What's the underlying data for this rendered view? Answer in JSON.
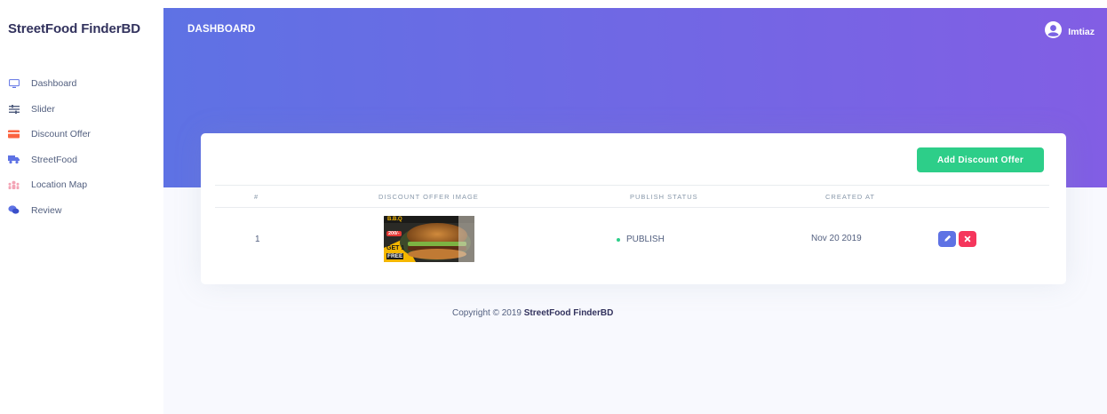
{
  "sidebar": {
    "brand": "StreetFood FinderBD",
    "items": [
      {
        "label": "Dashboard",
        "icon": "monitor-icon",
        "color": "#5e72e4"
      },
      {
        "label": "Slider",
        "icon": "sliders-icon",
        "color": "#525f7f"
      },
      {
        "label": "Discount Offer",
        "icon": "credit-card-icon",
        "color": "#fb6340"
      },
      {
        "label": "StreetFood",
        "icon": "delivery-truck-icon",
        "color": "#5e72e4"
      },
      {
        "label": "Location Map",
        "icon": "map-people-icon",
        "color": "#f3a4b5"
      },
      {
        "label": "Review",
        "icon": "review-bubble-icon",
        "color": "#5e72e4"
      }
    ]
  },
  "header": {
    "title": "DASHBOARD",
    "user_name": "Imtiaz",
    "gradient_start": "#5e72e4",
    "gradient_end": "#825ee4"
  },
  "card": {
    "add_button": "Add Discount Offer",
    "columns": [
      "#",
      "DISCOUNT OFFER IMAGE",
      "PUBLISH STATUS",
      "CREATED AT"
    ],
    "rows": [
      {
        "index": "1",
        "image_caption": {
          "line1": "B.B.Q",
          "badge": "200/-",
          "line2": "GET 1",
          "line3": "FREE"
        },
        "status": "PUBLISH",
        "created_at": "Nov 20 2019"
      }
    ]
  },
  "footer": {
    "prefix": "Copyright © 2019",
    "brand": "StreetFood FinderBD"
  }
}
